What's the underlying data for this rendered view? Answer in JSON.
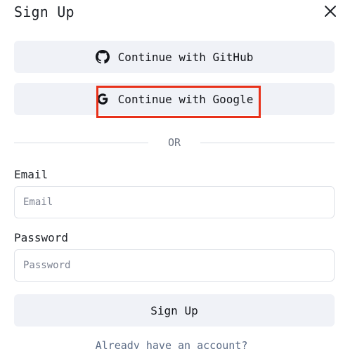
{
  "dialog": {
    "title": "Sign Up"
  },
  "oauth": {
    "github_label": "Continue with GitHub",
    "google_label": "Continue with Google"
  },
  "divider": {
    "text": "OR"
  },
  "form": {
    "email_label": "Email",
    "email_placeholder": "Email",
    "email_value": "",
    "password_label": "Password",
    "password_placeholder": "Password",
    "password_value": "",
    "submit_label": "Sign Up"
  },
  "footer": {
    "signin_link": "Already have an account?"
  },
  "icons": {
    "close": "close-icon",
    "github": "github-icon",
    "google": "google-icon"
  },
  "colors": {
    "button_bg": "#f0f2f7",
    "highlight": "#e8311a",
    "input_border": "#dfe2e8",
    "divider": "#d8dbe2"
  }
}
